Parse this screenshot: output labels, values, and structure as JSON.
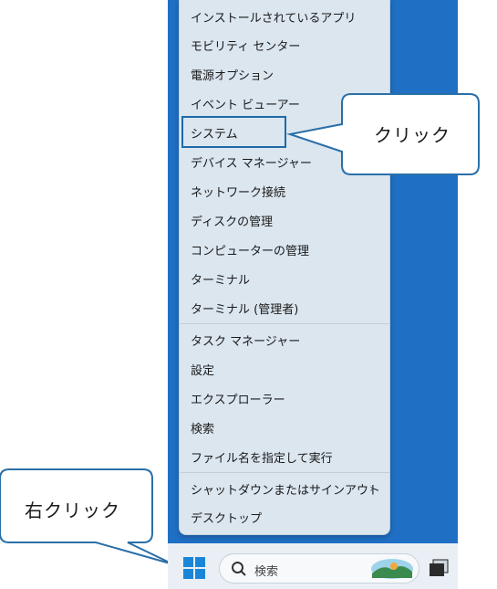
{
  "context_menu": {
    "items": [
      {
        "label": "インストールされているアプリ"
      },
      {
        "label": "モビリティ センター"
      },
      {
        "label": "電源オプション"
      },
      {
        "label": "イベント ビューアー"
      },
      {
        "label": "システム"
      },
      {
        "label": "デバイス マネージャー"
      },
      {
        "label": "ネットワーク接続"
      },
      {
        "label": "ディスクの管理"
      },
      {
        "label": "コンピューターの管理"
      },
      {
        "label": "ターミナル"
      },
      {
        "label": "ターミナル (管理者)"
      },
      {
        "label": "タスク マネージャー"
      },
      {
        "label": "設定"
      },
      {
        "label": "エクスプローラー"
      },
      {
        "label": "検索"
      },
      {
        "label": "ファイル名を指定して実行"
      },
      {
        "label": "シャットダウンまたはサインアウト",
        "submenu_glyph": "›"
      },
      {
        "label": "デスクトップ"
      }
    ]
  },
  "callouts": {
    "click": "クリック",
    "right_click": "右クリック"
  },
  "taskbar": {
    "search_placeholder": "検索",
    "start_icon": "windows-logo-icon",
    "search_icon": "magnifier-icon"
  },
  "colors": {
    "desktop": "#1f6fc4",
    "menu_bg": "#dbe6ef",
    "highlight_border": "#1f6aa8",
    "callout_border": "#2a6fa8"
  }
}
